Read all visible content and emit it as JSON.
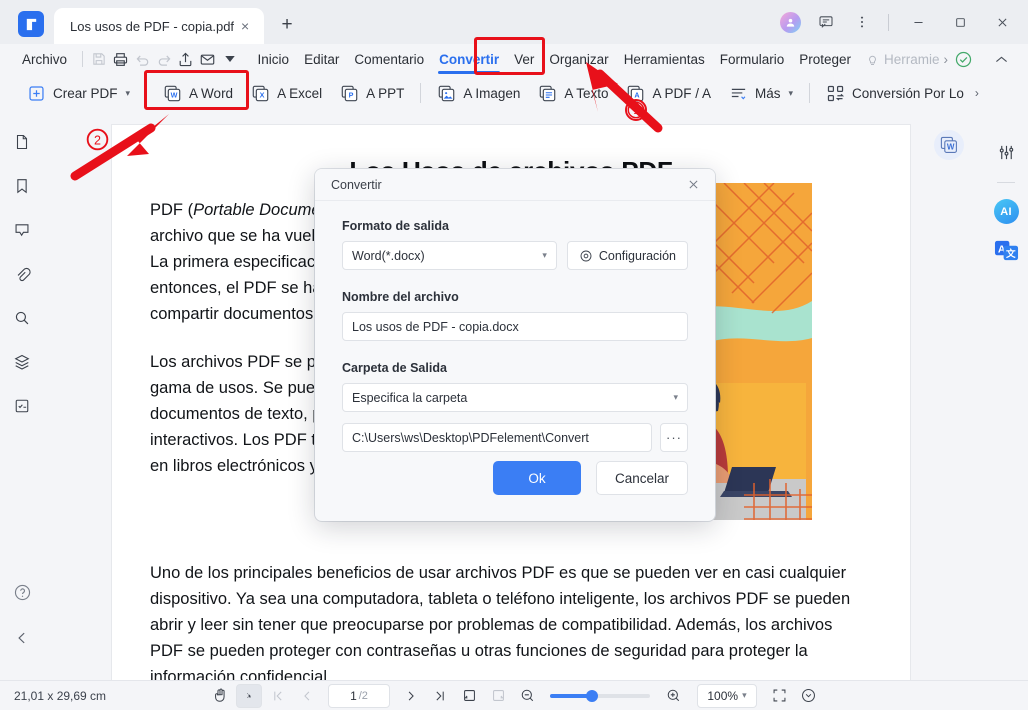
{
  "titlebar": {
    "tab_title": "Los usos de PDF - copia.pdf",
    "new_tab_label": "+",
    "close_label": "×",
    "minimize_label": "—",
    "maximize_label": "□",
    "window_close_label": "✕"
  },
  "menubar": {
    "archivo": "Archivo",
    "items": [
      {
        "label": "Inicio",
        "active": false
      },
      {
        "label": "Editar",
        "active": false
      },
      {
        "label": "Comentario",
        "active": false
      },
      {
        "label": "Convertir",
        "active": true
      },
      {
        "label": "Ver",
        "active": false
      },
      {
        "label": "Organizar",
        "active": false
      },
      {
        "label": "Herramientas",
        "active": false
      },
      {
        "label": "Formulario",
        "active": false
      },
      {
        "label": "Proteger",
        "active": false
      }
    ],
    "tools_hint": "Herramie",
    "tools_chevron": "›"
  },
  "ribbon": {
    "items": [
      {
        "label": "Crear PDF",
        "icon": "plus-square-icon",
        "dropdown": true
      },
      {
        "label": "A Word",
        "icon": "word-file-icon",
        "dropdown": false
      },
      {
        "label": "A Excel",
        "icon": "excel-file-icon",
        "dropdown": false
      },
      {
        "label": "A PPT",
        "icon": "ppt-file-icon",
        "dropdown": false
      },
      {
        "label": "A Imagen",
        "icon": "image-file-icon",
        "dropdown": false
      },
      {
        "label": "A Texto",
        "icon": "text-file-icon",
        "dropdown": false
      },
      {
        "label": "A PDF / A",
        "icon": "pdfa-file-icon",
        "dropdown": false
      },
      {
        "label": "Más",
        "icon": "more-lines-icon",
        "dropdown": true
      },
      {
        "label": "Conversión Por Lo",
        "icon": "batch-convert-icon",
        "dropdown": false
      }
    ]
  },
  "left_rail": {
    "icons": [
      "page-thumbnail-icon",
      "bookmark-icon",
      "comment-icon",
      "attachment-icon",
      "search-icon",
      "layers-icon",
      "form-field-icon"
    ],
    "help_icon": "help-circle-icon",
    "collapse_icon": "chevron-left-icon"
  },
  "right_rail": {
    "settings_icon": "sliders-icon",
    "ai_label": "AI",
    "translate_label": "A",
    "translate_sub": "文"
  },
  "document": {
    "title": "Los Usos de archivos PDF",
    "paragraphs": [
      "PDF (Portable Document Format) es un formato de archivo que se ha vuelto omnipresente en la era digital. La primera especificación se publicó en 1993. Desde entonces, el PDF se ha convertido en el estándar para compartir documentos en línea.",
      "Los archivos PDF se pueden utilizar para una amplia gama de usos. Se pueden utilizar para crear documentos de texto, presentaciones y formularios interactivos. Los PDF también se utilizan ampliamente en libros electrónicos y revistas digitales.",
      "Uno de los principales beneficios de usar archivos PDF es que se pueden ver en casi cualquier dispositivo. Ya sea una computadora, tableta o teléfono inteligente, los archivos PDF se pueden abrir y leer sin tener que preocuparse por problemas de compatibilidad. Además, los archivos PDF se pueden proteger con contraseñas u otras funciones de seguridad para proteger la información confidencial."
    ],
    "paragraph_1_italic": "Portable Document Format",
    "cover_word_icon": "word-watermark-icon"
  },
  "dialog": {
    "title": "Convertir",
    "close_label": "✕",
    "format_label": "Formato de salida",
    "format_value": "Word(*.docx)",
    "settings_button": "Configuración",
    "filename_label": "Nombre del archivo",
    "filename_value": "Los usos de PDF - copia.docx",
    "folder_label": "Carpeta de Salida",
    "folder_select_value": "Especifica la carpeta",
    "folder_path_value": "C:\\Users\\ws\\Desktop\\PDFelement\\Convert",
    "browse_label": "···",
    "ok_label": "Ok",
    "cancel_label": "Cancelar"
  },
  "statusbar": {
    "page_size": "21,01 x 29,69 cm",
    "hand_tool": "hand-tool-icon",
    "select_tool": "select-tool-icon",
    "first_page": "|‹",
    "prev_page": "‹",
    "page_current": "1",
    "page_total": "/2",
    "next_page": "›",
    "last_page": "›|",
    "single_page_icon": "single-page-view-icon",
    "facing_page_icon": "facing-page-view-icon",
    "zoom_out": "−",
    "zoom_in": "+",
    "zoom_value": "100%",
    "fullscreen_icon": "fullscreen-icon",
    "more_icon": "chevron-down-circle-icon"
  },
  "annotations": {
    "marker_one": "①",
    "marker_two": "②",
    "highlight_color": "#e8101a"
  }
}
